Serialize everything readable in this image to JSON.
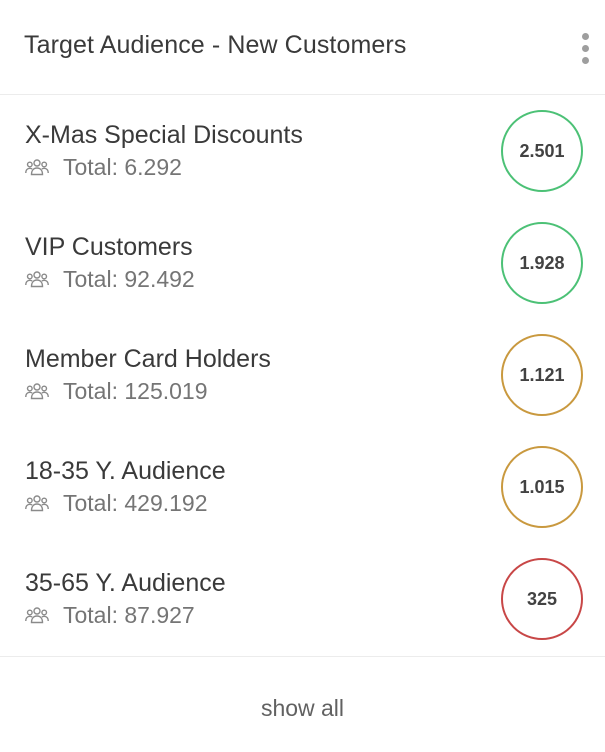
{
  "header": {
    "title": "Target Audience - New Customers",
    "menu_icon": "more-vertical-icon"
  },
  "list": {
    "items": [
      {
        "name": "X-Mas Special Discounts",
        "total": "Total: 6.292",
        "score": "2.501",
        "score_color": "#4cc176",
        "icon": "people-group-icon"
      },
      {
        "name": "VIP Customers",
        "total": "Total: 92.492",
        "score": "1.928",
        "score_color": "#4cc176",
        "icon": "people-group-icon"
      },
      {
        "name": "Member Card Holders",
        "total": "Total: 125.019",
        "score": "1.121",
        "score_color": "#c9993f",
        "icon": "people-group-icon"
      },
      {
        "name": "18-35 Y. Audience",
        "total": "Total: 429.192",
        "score": "1.015",
        "score_color": "#c9993f",
        "icon": "people-group-icon"
      },
      {
        "name": "35-65 Y. Audience",
        "total": "Total: 87.927",
        "score": "325",
        "score_color": "#c84747",
        "icon": "people-group-icon"
      }
    ]
  },
  "footer": {
    "show_all_label": "show all"
  }
}
